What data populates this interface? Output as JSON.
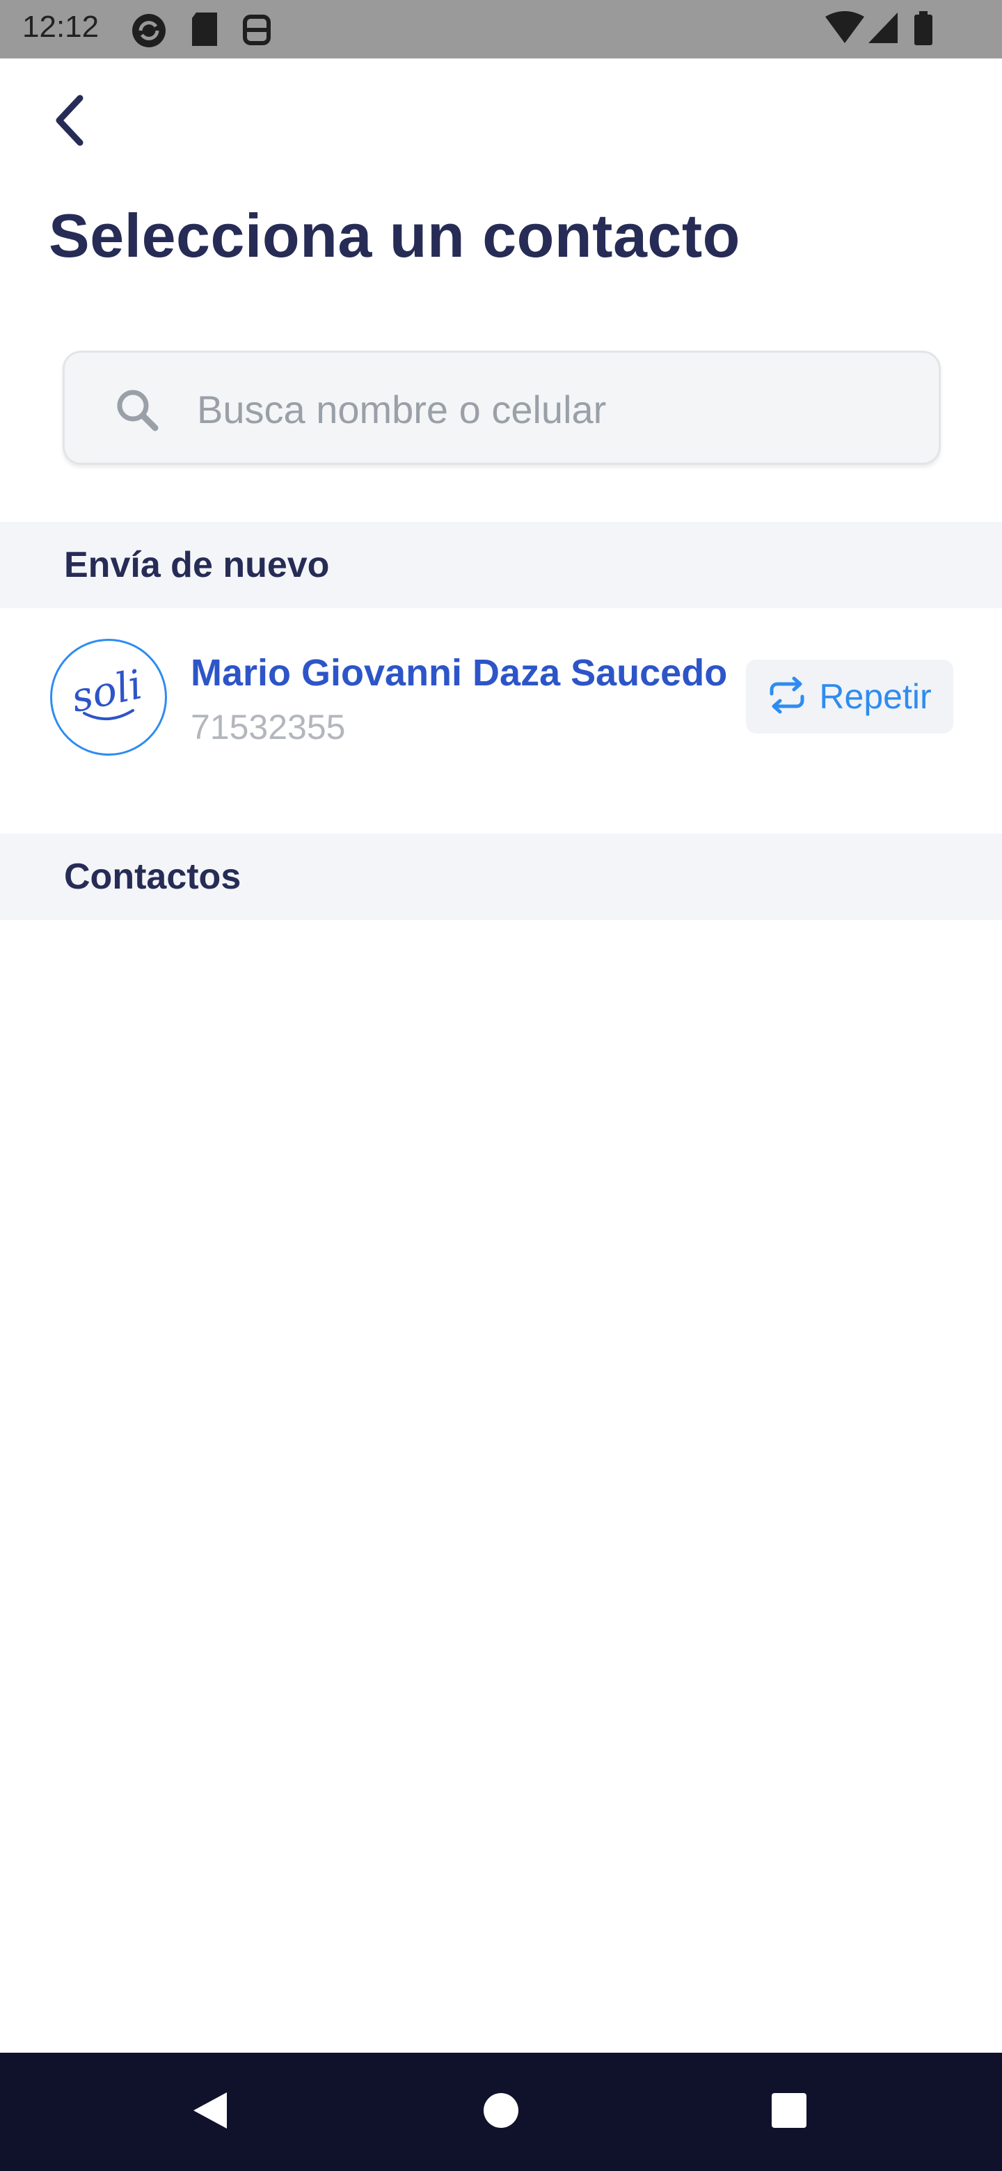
{
  "status_bar": {
    "time": "12:12"
  },
  "header": {
    "back_icon": "chevron-left-icon",
    "title": "Selecciona un contacto"
  },
  "search": {
    "icon": "search-icon",
    "placeholder": "Busca nombre o celular",
    "value": ""
  },
  "sections": {
    "recent": {
      "label": "Envía de nuevo",
      "contacts": [
        {
          "avatar_text": "soli",
          "name": "Mario Giovanni Daza Saucedo",
          "phone": "71532355",
          "action_label": "Repetir",
          "action_icon": "repeat-icon"
        }
      ]
    },
    "contacts": {
      "label": "Contactos"
    }
  },
  "colors": {
    "title": "#262c55",
    "accent_blue": "#2e8cf0",
    "name_blue": "#2d55c8",
    "section_bg": "#f4f5f8",
    "nav_bar": "#10122b"
  }
}
